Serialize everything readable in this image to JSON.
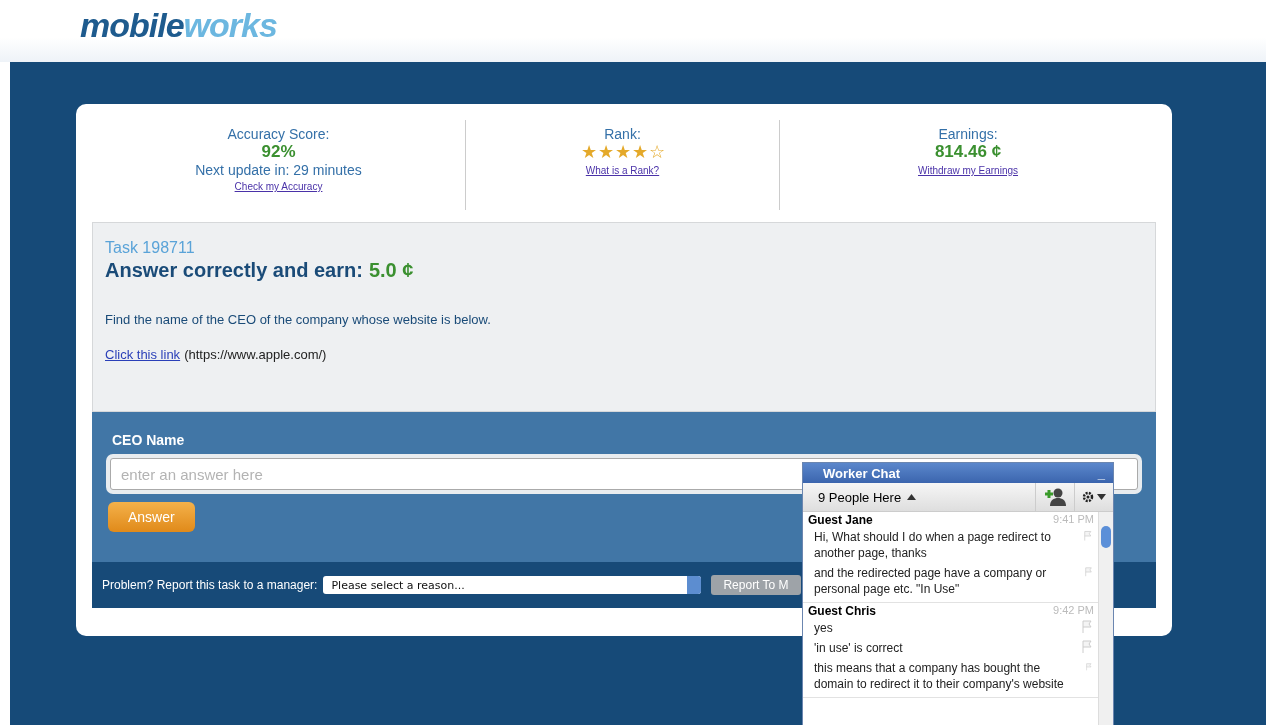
{
  "logo": {
    "dark": "mobile",
    "light": "works"
  },
  "stats": {
    "accuracy": {
      "label": "Accuracy Score:",
      "value": "92%",
      "next": "Next update in: 29 minutes",
      "link": "Check my Accuracy"
    },
    "rank": {
      "label": "Rank:",
      "stars": 4,
      "link": "What is a Rank?"
    },
    "earnings": {
      "label": "Earnings:",
      "value": "814.46 ¢",
      "link": "Withdraw my Earnings"
    }
  },
  "task": {
    "id": "Task 198711",
    "heading": "Answer correctly and earn:",
    "reward": "5.0 ¢",
    "instruction": "Find the name of the CEO of the company whose website is below.",
    "link": "Click this link",
    "url": "(https://www.apple.com/)"
  },
  "form": {
    "label": "CEO Name",
    "placeholder": "enter an answer here",
    "button": "Answer"
  },
  "report": {
    "label": "Problem? Report this task to a manager:",
    "select": "Please select a reason...",
    "button": "Report To M"
  },
  "chat": {
    "title": "Worker Chat",
    "minimize": "_",
    "people": "9 People Here",
    "groups": [
      {
        "author": "Guest Jane",
        "time": "9:41 PM",
        "messages": [
          "Hi, What should I do when a page redirect to another page, thanks",
          "and the redirected page have a company or personal page etc. \"In Use\""
        ]
      },
      {
        "author": "Guest Chris",
        "time": "9:42 PM",
        "messages": [
          "yes",
          "'in use' is correct",
          "this means that a company has bought the domain to redirect it to their company's website"
        ]
      }
    ]
  }
}
